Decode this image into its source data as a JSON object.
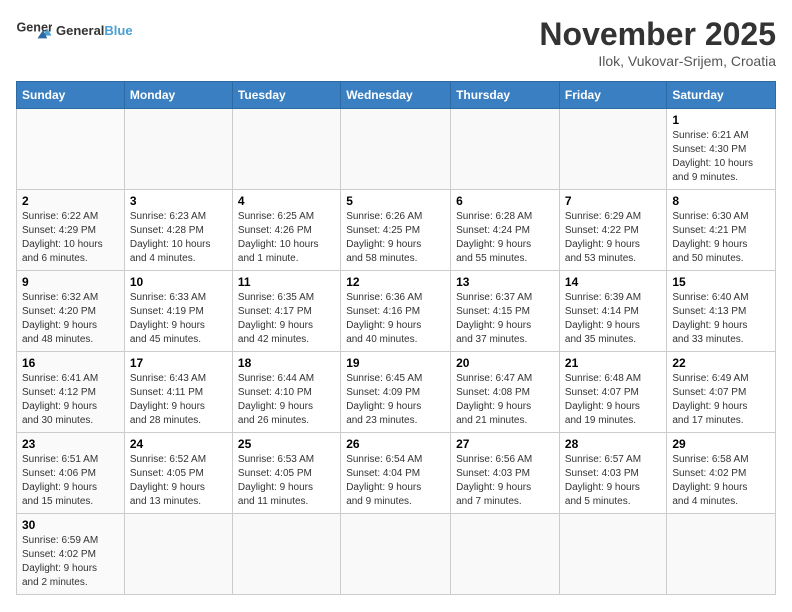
{
  "header": {
    "logo_general": "General",
    "logo_blue": "Blue",
    "month_title": "November 2025",
    "location": "Ilok, Vukovar-Srijem, Croatia"
  },
  "columns": [
    "Sunday",
    "Monday",
    "Tuesday",
    "Wednesday",
    "Thursday",
    "Friday",
    "Saturday"
  ],
  "weeks": [
    [
      {
        "day": "",
        "info": ""
      },
      {
        "day": "",
        "info": ""
      },
      {
        "day": "",
        "info": ""
      },
      {
        "day": "",
        "info": ""
      },
      {
        "day": "",
        "info": ""
      },
      {
        "day": "",
        "info": ""
      },
      {
        "day": "1",
        "info": "Sunrise: 6:21 AM\nSunset: 4:30 PM\nDaylight: 10 hours\nand 9 minutes."
      }
    ],
    [
      {
        "day": "2",
        "info": "Sunrise: 6:22 AM\nSunset: 4:29 PM\nDaylight: 10 hours\nand 6 minutes."
      },
      {
        "day": "3",
        "info": "Sunrise: 6:23 AM\nSunset: 4:28 PM\nDaylight: 10 hours\nand 4 minutes."
      },
      {
        "day": "4",
        "info": "Sunrise: 6:25 AM\nSunset: 4:26 PM\nDaylight: 10 hours\nand 1 minute."
      },
      {
        "day": "5",
        "info": "Sunrise: 6:26 AM\nSunset: 4:25 PM\nDaylight: 9 hours\nand 58 minutes."
      },
      {
        "day": "6",
        "info": "Sunrise: 6:28 AM\nSunset: 4:24 PM\nDaylight: 9 hours\nand 55 minutes."
      },
      {
        "day": "7",
        "info": "Sunrise: 6:29 AM\nSunset: 4:22 PM\nDaylight: 9 hours\nand 53 minutes."
      },
      {
        "day": "8",
        "info": "Sunrise: 6:30 AM\nSunset: 4:21 PM\nDaylight: 9 hours\nand 50 minutes."
      }
    ],
    [
      {
        "day": "9",
        "info": "Sunrise: 6:32 AM\nSunset: 4:20 PM\nDaylight: 9 hours\nand 48 minutes."
      },
      {
        "day": "10",
        "info": "Sunrise: 6:33 AM\nSunset: 4:19 PM\nDaylight: 9 hours\nand 45 minutes."
      },
      {
        "day": "11",
        "info": "Sunrise: 6:35 AM\nSunset: 4:17 PM\nDaylight: 9 hours\nand 42 minutes."
      },
      {
        "day": "12",
        "info": "Sunrise: 6:36 AM\nSunset: 4:16 PM\nDaylight: 9 hours\nand 40 minutes."
      },
      {
        "day": "13",
        "info": "Sunrise: 6:37 AM\nSunset: 4:15 PM\nDaylight: 9 hours\nand 37 minutes."
      },
      {
        "day": "14",
        "info": "Sunrise: 6:39 AM\nSunset: 4:14 PM\nDaylight: 9 hours\nand 35 minutes."
      },
      {
        "day": "15",
        "info": "Sunrise: 6:40 AM\nSunset: 4:13 PM\nDaylight: 9 hours\nand 33 minutes."
      }
    ],
    [
      {
        "day": "16",
        "info": "Sunrise: 6:41 AM\nSunset: 4:12 PM\nDaylight: 9 hours\nand 30 minutes."
      },
      {
        "day": "17",
        "info": "Sunrise: 6:43 AM\nSunset: 4:11 PM\nDaylight: 9 hours\nand 28 minutes."
      },
      {
        "day": "18",
        "info": "Sunrise: 6:44 AM\nSunset: 4:10 PM\nDaylight: 9 hours\nand 26 minutes."
      },
      {
        "day": "19",
        "info": "Sunrise: 6:45 AM\nSunset: 4:09 PM\nDaylight: 9 hours\nand 23 minutes."
      },
      {
        "day": "20",
        "info": "Sunrise: 6:47 AM\nSunset: 4:08 PM\nDaylight: 9 hours\nand 21 minutes."
      },
      {
        "day": "21",
        "info": "Sunrise: 6:48 AM\nSunset: 4:07 PM\nDaylight: 9 hours\nand 19 minutes."
      },
      {
        "day": "22",
        "info": "Sunrise: 6:49 AM\nSunset: 4:07 PM\nDaylight: 9 hours\nand 17 minutes."
      }
    ],
    [
      {
        "day": "23",
        "info": "Sunrise: 6:51 AM\nSunset: 4:06 PM\nDaylight: 9 hours\nand 15 minutes."
      },
      {
        "day": "24",
        "info": "Sunrise: 6:52 AM\nSunset: 4:05 PM\nDaylight: 9 hours\nand 13 minutes."
      },
      {
        "day": "25",
        "info": "Sunrise: 6:53 AM\nSunset: 4:05 PM\nDaylight: 9 hours\nand 11 minutes."
      },
      {
        "day": "26",
        "info": "Sunrise: 6:54 AM\nSunset: 4:04 PM\nDaylight: 9 hours\nand 9 minutes."
      },
      {
        "day": "27",
        "info": "Sunrise: 6:56 AM\nSunset: 4:03 PM\nDaylight: 9 hours\nand 7 minutes."
      },
      {
        "day": "28",
        "info": "Sunrise: 6:57 AM\nSunset: 4:03 PM\nDaylight: 9 hours\nand 5 minutes."
      },
      {
        "day": "29",
        "info": "Sunrise: 6:58 AM\nSunset: 4:02 PM\nDaylight: 9 hours\nand 4 minutes."
      }
    ],
    [
      {
        "day": "30",
        "info": "Sunrise: 6:59 AM\nSunset: 4:02 PM\nDaylight: 9 hours\nand 2 minutes."
      },
      {
        "day": "",
        "info": ""
      },
      {
        "day": "",
        "info": ""
      },
      {
        "day": "",
        "info": ""
      },
      {
        "day": "",
        "info": ""
      },
      {
        "day": "",
        "info": ""
      },
      {
        "day": "",
        "info": ""
      }
    ]
  ]
}
